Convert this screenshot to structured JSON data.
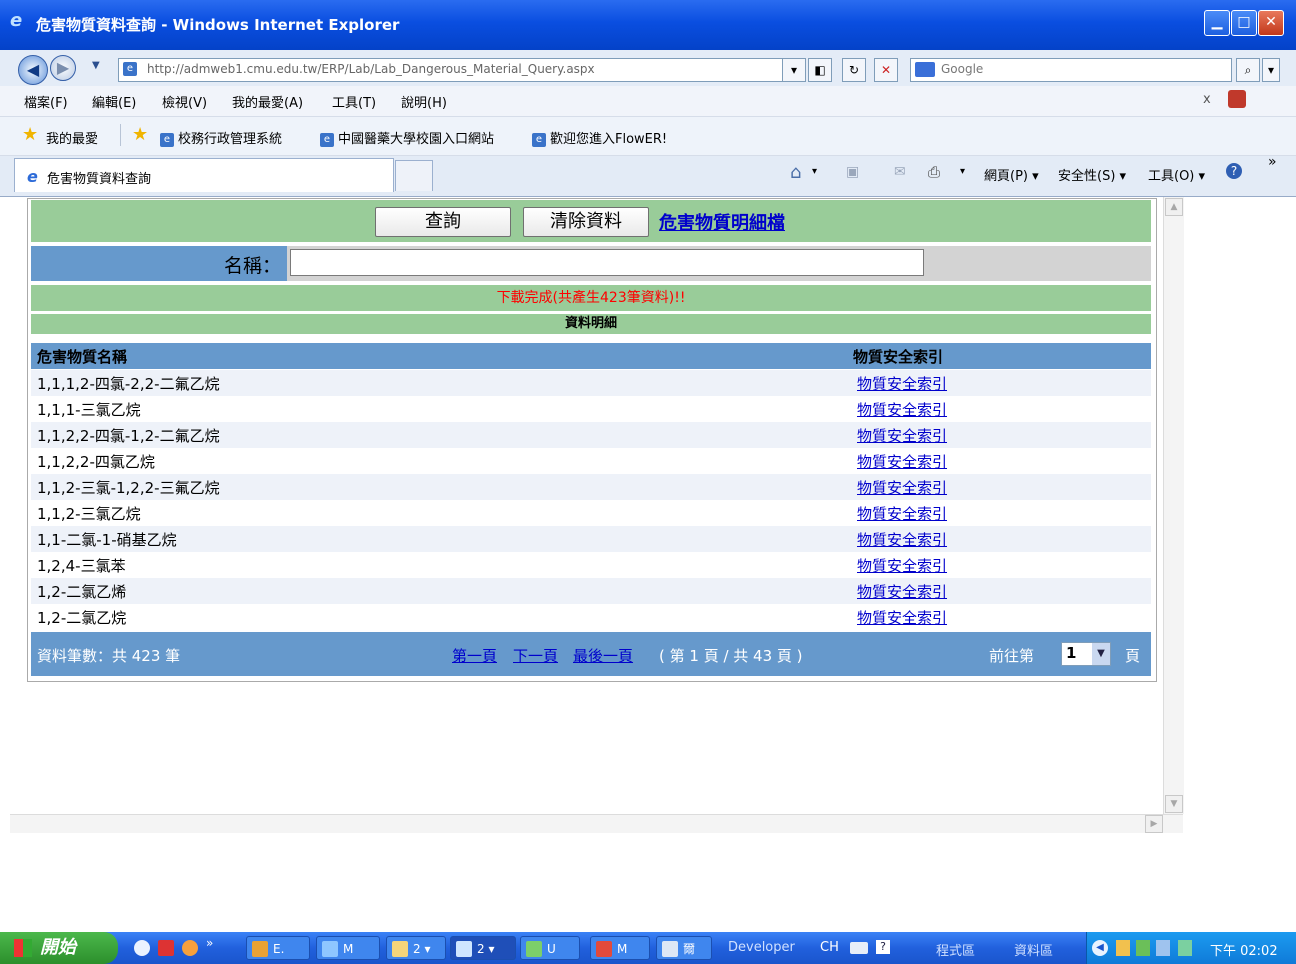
{
  "window": {
    "title": "危害物質資料查詢 - Windows Internet Explorer",
    "minimize_glyph": "▁",
    "maximize_glyph": "□",
    "close_glyph": "✕"
  },
  "navbar": {
    "url": "http://admweb1.cmu.edu.tw/ERP/Lab/Lab_Dangerous_Material_Query.aspx",
    "search_placeholder": "Google",
    "icons": [
      "back-icon",
      "forward-icon",
      "compatibility-icon",
      "refresh-icon",
      "stop-icon",
      "search-icon"
    ]
  },
  "menubar": {
    "items": [
      "檔案(F)",
      "編輯(E)",
      "檢視(V)",
      "我的最愛(A)",
      "工具(T)",
      "說明(H)"
    ],
    "close_glyph": "x"
  },
  "favorites": {
    "label": "我的最愛",
    "links": [
      "校務行政管理系統",
      "中國醫藥大學校園入口網站",
      "歡迎您進入FlowER!"
    ]
  },
  "tabs": {
    "active_label": "危害物質資料查詢",
    "commands": [
      "網頁(P) ▾",
      "安全性(S) ▾",
      "工具(O) ▾"
    ]
  },
  "form": {
    "query_button": "查詢",
    "clear_button": "清除資料",
    "detail_link": "危害物質明細檔",
    "name_label": "名稱：",
    "name_value": "",
    "message": "下載完成(共產生423筆資料)!!",
    "detail_header": "資料明細"
  },
  "table": {
    "headers": [
      "危害物質名稱",
      "物質安全索引"
    ],
    "rows": [
      {
        "name": "1,1,1,2-四氯-2,2-二氟乙烷",
        "link": "物質安全索引"
      },
      {
        "name": "1,1,1-三氯乙烷",
        "link": "物質安全索引"
      },
      {
        "name": "1,1,2,2-四氯-1,2-二氟乙烷",
        "link": "物質安全索引"
      },
      {
        "name": "1,1,2,2-四氯乙烷",
        "link": "物質安全索引"
      },
      {
        "name": "1,1,2-三氯-1,2,2-三氟乙烷",
        "link": "物質安全索引"
      },
      {
        "name": "1,1,2-三氯乙烷",
        "link": "物質安全索引"
      },
      {
        "name": "1,1-二氯-1-硝基乙烷",
        "link": "物質安全索引"
      },
      {
        "name": "1,2,4-三氯苯",
        "link": "物質安全索引"
      },
      {
        "name": "1,2-二氯乙烯",
        "link": "物質安全索引"
      },
      {
        "name": "1,2-二氯乙烷",
        "link": "物質安全索引"
      }
    ]
  },
  "pager": {
    "count_text": "資料筆數：共 423 筆",
    "first": "第一頁",
    "next": "下一頁",
    "last": "最後一頁",
    "page_text": "( 第 1 頁 / 共 43 頁 )",
    "goto_text": "前往第",
    "selected_page": "1",
    "page_suffix": "頁"
  },
  "taskbar": {
    "start": "開始",
    "items": [
      "E.",
      "M",
      "2 ▾",
      "2 ▾",
      "U",
      "M",
      "爾"
    ],
    "tray_labels": [
      "Developer",
      "CH",
      "程式區",
      "資料區"
    ],
    "clock": "下午 02:02"
  },
  "colors": {
    "title_blue": "#0a4ee0",
    "green_row": "#99cc99",
    "blue_header": "#6699cc",
    "link": "#0000cc",
    "message_red": "#ff0000",
    "row_alt": "#eef2f9"
  }
}
